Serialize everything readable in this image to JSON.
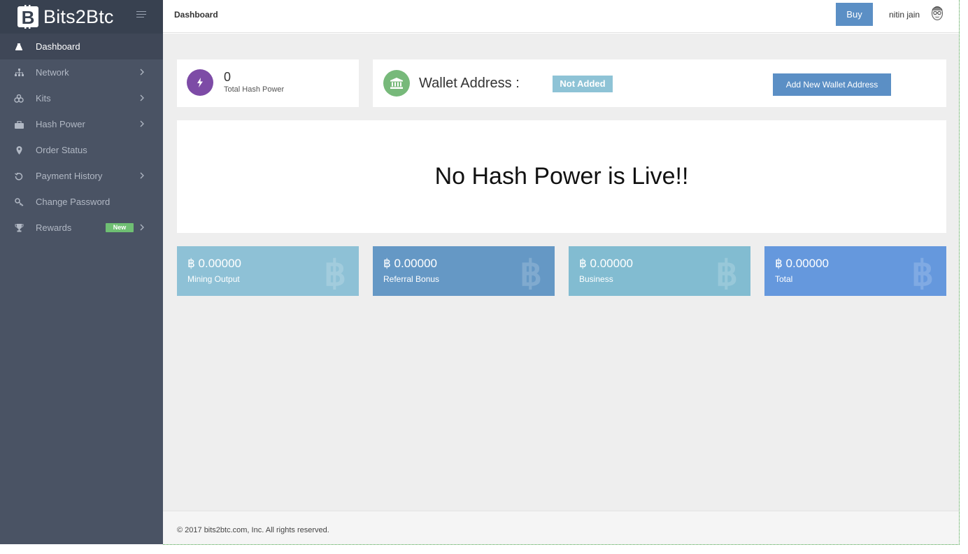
{
  "brand": {
    "name": "Bits2Btc"
  },
  "header": {
    "title": "Dashboard",
    "buy_label": "Buy",
    "user_name": "nitin jain"
  },
  "sidebar": {
    "items": [
      {
        "label": "Dashboard",
        "icon": "dashboard-icon",
        "active": true,
        "has_submenu": false
      },
      {
        "label": "Network",
        "icon": "network-icon",
        "active": false,
        "has_submenu": true
      },
      {
        "label": "Kits",
        "icon": "kits-icon",
        "active": false,
        "has_submenu": true
      },
      {
        "label": "Hash Power",
        "icon": "briefcase-icon",
        "active": false,
        "has_submenu": true
      },
      {
        "label": "Order Status",
        "icon": "map-marker-icon",
        "active": false,
        "has_submenu": false
      },
      {
        "label": "Payment History",
        "icon": "history-icon",
        "active": false,
        "has_submenu": true
      },
      {
        "label": "Change Password",
        "icon": "key-icon",
        "active": false,
        "has_submenu": false
      },
      {
        "label": "Rewards",
        "icon": "trophy-icon",
        "active": false,
        "has_submenu": true,
        "badge": "New"
      }
    ]
  },
  "hash_power": {
    "value": "0",
    "label": "Total Hash Power"
  },
  "wallet": {
    "label": "Wallet Address :",
    "status": "Not Added",
    "add_button_label": "Add New Wallet Address"
  },
  "live_message": "No Hash Power is Live!!",
  "stats": [
    {
      "value": "0.00000",
      "label": "Mining Output",
      "color": "#8ec1d6"
    },
    {
      "value": "0.00000",
      "label": "Referral Bonus",
      "color": "#6598c5"
    },
    {
      "value": "0.00000",
      "label": "Business",
      "color": "#82bcd1"
    },
    {
      "value": "0.00000",
      "label": "Total",
      "color": "#6598dd"
    }
  ],
  "footer": {
    "text": "© 2017 bits2btc.com, Inc. All rights reserved."
  },
  "colors": {
    "sidebar_bg": "#4a5364",
    "brand_bg": "#384150",
    "primary_button": "#5b8fc5",
    "hash_icon_bg": "#7d4ba6",
    "wallet_icon_bg": "#77b97a",
    "badge_new": "#6fbf73"
  }
}
